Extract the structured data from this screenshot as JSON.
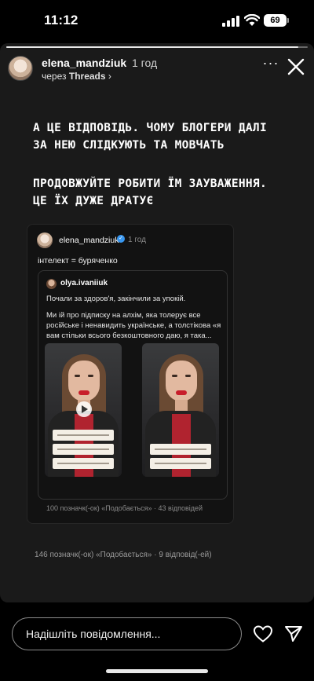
{
  "status_bar": {
    "time": "11:12",
    "battery": "69"
  },
  "story": {
    "progress_fraction": 0.97,
    "author": {
      "username": "elena_mandziuk",
      "posted_ago": "1 год",
      "via_prefix": "через",
      "via_app": "Threads"
    },
    "text_block_1": "А ЦЕ ВІДПОВІДЬ. ЧОМУ БЛОГЕРИ ДАЛІ ЗА НЕЮ СЛІДКУЮТЬ ТА МОВЧАТЬ",
    "text_block_2": "ПРОДОВЖУЙТЕ РОБИТИ ЇМ ЗАУВАЖЕННЯ. ЦЕ ЇХ ДУЖЕ ДРАТУЄ",
    "threads_post": {
      "username": "elena_mandziuk",
      "posted_ago": "1 год",
      "text": "інтелект = буряченко",
      "quoted_post": {
        "username": "olya.ivaniiuk",
        "line1": "Почали за здоров'я, закінчили за упокій.",
        "line2": "Ми ій про підписку на алхім, яка толерує все російське і ненавидить українське, а толстікова «я вам стільки всього безкоштовного даю, я така...",
        "thumbnails": [
          {
            "has_play_icon": true,
            "caption_tags": 3
          },
          {
            "has_play_icon": false,
            "caption_tags": 2
          }
        ]
      },
      "stats": "100 позначк(-ок) «Подобається» · 43 відповідей"
    },
    "bottom_stats": "146 позначк(-ок) «Подобається» · 9 відповід(-ей)"
  },
  "reply_bar": {
    "placeholder": "Надішліть повідомлення..."
  },
  "icons": {
    "more": "more-icon",
    "close": "close-icon",
    "like": "heart-icon",
    "send": "send-icon",
    "verified": "verified-badge-icon"
  }
}
